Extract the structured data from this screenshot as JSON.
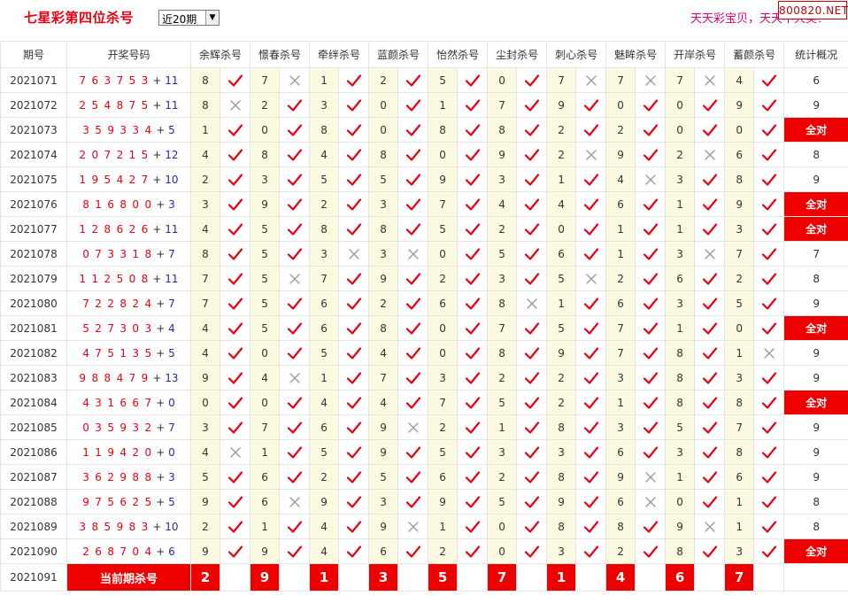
{
  "header": {
    "title": "七星彩第四位杀号",
    "period_select": "近20期",
    "slogan": "天天彩宝贝，天天中大奖！",
    "watermark": "800820.NET"
  },
  "columns": {
    "issue": "期号",
    "draw": "开奖号码",
    "experts": [
      "余辉杀号",
      "憬春杀号",
      "牵绊杀号",
      "蓝颜杀号",
      "怡然杀号",
      "尘封杀号",
      "刺心杀号",
      "魅眸杀号",
      "开岸杀号",
      "蓄颜杀号"
    ],
    "stat": "统计概况"
  },
  "colors": {
    "accent": "#ee0000",
    "check": "#e60012",
    "cross": "#9a9a9a",
    "num_bg": "#fcfbe2"
  },
  "rows": [
    {
      "issue": "2021071",
      "draw": "763753",
      "extra": "11",
      "kills": [
        8,
        7,
        1,
        2,
        5,
        0,
        7,
        7,
        7,
        4
      ],
      "hits": [
        1,
        0,
        1,
        1,
        1,
        1,
        0,
        0,
        0,
        1
      ],
      "stat": "6"
    },
    {
      "issue": "2021072",
      "draw": "254875",
      "extra": "11",
      "kills": [
        8,
        2,
        3,
        0,
        1,
        7,
        9,
        0,
        0,
        9
      ],
      "hits": [
        0,
        1,
        1,
        1,
        1,
        1,
        1,
        1,
        1,
        1
      ],
      "stat": "9"
    },
    {
      "issue": "2021073",
      "draw": "359334",
      "extra": "5",
      "kills": [
        1,
        0,
        8,
        0,
        8,
        8,
        2,
        2,
        0,
        0
      ],
      "hits": [
        1,
        1,
        1,
        1,
        1,
        1,
        1,
        1,
        1,
        1
      ],
      "stat": "全对"
    },
    {
      "issue": "2021074",
      "draw": "207215",
      "extra": "12",
      "kills": [
        4,
        8,
        4,
        8,
        0,
        9,
        2,
        9,
        2,
        6
      ],
      "hits": [
        1,
        1,
        1,
        1,
        1,
        1,
        0,
        1,
        0,
        1
      ],
      "stat": "8"
    },
    {
      "issue": "2021075",
      "draw": "195427",
      "extra": "10",
      "kills": [
        2,
        3,
        5,
        5,
        9,
        3,
        1,
        4,
        3,
        8
      ],
      "hits": [
        1,
        1,
        1,
        1,
        1,
        1,
        1,
        0,
        1,
        1
      ],
      "stat": "9"
    },
    {
      "issue": "2021076",
      "draw": "816800",
      "extra": "3",
      "kills": [
        3,
        9,
        2,
        3,
        7,
        4,
        4,
        6,
        1,
        9
      ],
      "hits": [
        1,
        1,
        1,
        1,
        1,
        1,
        1,
        1,
        1,
        1
      ],
      "stat": "全对"
    },
    {
      "issue": "2021077",
      "draw": "128626",
      "extra": "11",
      "kills": [
        4,
        5,
        8,
        8,
        5,
        2,
        0,
        1,
        1,
        3
      ],
      "hits": [
        1,
        1,
        1,
        1,
        1,
        1,
        1,
        1,
        1,
        1
      ],
      "stat": "全对"
    },
    {
      "issue": "2021078",
      "draw": "073318",
      "extra": "7",
      "kills": [
        8,
        5,
        3,
        3,
        0,
        5,
        6,
        1,
        3,
        7
      ],
      "hits": [
        1,
        1,
        0,
        0,
        1,
        1,
        1,
        1,
        0,
        1
      ],
      "stat": "7"
    },
    {
      "issue": "2021079",
      "draw": "112508",
      "extra": "11",
      "kills": [
        7,
        5,
        7,
        9,
        2,
        3,
        5,
        2,
        6,
        2
      ],
      "hits": [
        1,
        0,
        1,
        1,
        1,
        1,
        0,
        1,
        1,
        1
      ],
      "stat": "8"
    },
    {
      "issue": "2021080",
      "draw": "722824",
      "extra": "7",
      "kills": [
        7,
        5,
        6,
        2,
        6,
        8,
        1,
        6,
        3,
        5
      ],
      "hits": [
        1,
        1,
        1,
        1,
        1,
        0,
        1,
        1,
        1,
        1
      ],
      "stat": "9"
    },
    {
      "issue": "2021081",
      "draw": "527303",
      "extra": "4",
      "kills": [
        4,
        5,
        6,
        8,
        0,
        7,
        5,
        7,
        1,
        0
      ],
      "hits": [
        1,
        1,
        1,
        1,
        1,
        1,
        1,
        1,
        1,
        1
      ],
      "stat": "全对"
    },
    {
      "issue": "2021082",
      "draw": "475135",
      "extra": "5",
      "kills": [
        4,
        0,
        5,
        4,
        0,
        8,
        9,
        7,
        8,
        1
      ],
      "hits": [
        1,
        1,
        1,
        1,
        1,
        1,
        1,
        1,
        1,
        0
      ],
      "stat": "9"
    },
    {
      "issue": "2021083",
      "draw": "988479",
      "extra": "13",
      "kills": [
        9,
        4,
        1,
        7,
        3,
        2,
        2,
        3,
        8,
        3
      ],
      "hits": [
        1,
        0,
        1,
        1,
        1,
        1,
        1,
        1,
        1,
        1
      ],
      "stat": "9"
    },
    {
      "issue": "2021084",
      "draw": "431667",
      "extra": "0",
      "kills": [
        0,
        0,
        4,
        4,
        7,
        5,
        2,
        1,
        8,
        8
      ],
      "hits": [
        1,
        1,
        1,
        1,
        1,
        1,
        1,
        1,
        1,
        1
      ],
      "stat": "全对"
    },
    {
      "issue": "2021085",
      "draw": "035932",
      "extra": "7",
      "kills": [
        3,
        7,
        6,
        9,
        2,
        1,
        8,
        3,
        5,
        7
      ],
      "hits": [
        1,
        1,
        1,
        0,
        1,
        1,
        1,
        1,
        1,
        1
      ],
      "stat": "9"
    },
    {
      "issue": "2021086",
      "draw": "119420",
      "extra": "0",
      "kills": [
        4,
        1,
        5,
        9,
        5,
        3,
        3,
        6,
        3,
        8
      ],
      "hits": [
        0,
        1,
        1,
        1,
        1,
        1,
        1,
        1,
        1,
        1
      ],
      "stat": "9"
    },
    {
      "issue": "2021087",
      "draw": "362988",
      "extra": "3",
      "kills": [
        5,
        6,
        2,
        5,
        6,
        2,
        8,
        9,
        1,
        6
      ],
      "hits": [
        1,
        1,
        1,
        1,
        1,
        1,
        1,
        0,
        1,
        1
      ],
      "stat": "9"
    },
    {
      "issue": "2021088",
      "draw": "975625",
      "extra": "5",
      "kills": [
        9,
        6,
        9,
        3,
        9,
        5,
        9,
        6,
        0,
        1
      ],
      "hits": [
        1,
        0,
        1,
        1,
        1,
        1,
        1,
        0,
        1,
        1
      ],
      "stat": "8"
    },
    {
      "issue": "2021089",
      "draw": "385983",
      "extra": "10",
      "kills": [
        2,
        1,
        4,
        9,
        1,
        0,
        8,
        8,
        9,
        1
      ],
      "hits": [
        1,
        1,
        1,
        0,
        1,
        1,
        1,
        1,
        0,
        1
      ],
      "stat": "8"
    },
    {
      "issue": "2021090",
      "draw": "268704",
      "extra": "6",
      "kills": [
        9,
        9,
        4,
        6,
        2,
        0,
        3,
        2,
        8,
        3
      ],
      "hits": [
        1,
        1,
        1,
        1,
        1,
        1,
        1,
        1,
        1,
        1
      ],
      "stat": "全对"
    }
  ],
  "current": {
    "issue": "2021091",
    "label": "当前期杀号",
    "kills": [
      2,
      9,
      1,
      3,
      5,
      7,
      1,
      4,
      6,
      7
    ]
  }
}
